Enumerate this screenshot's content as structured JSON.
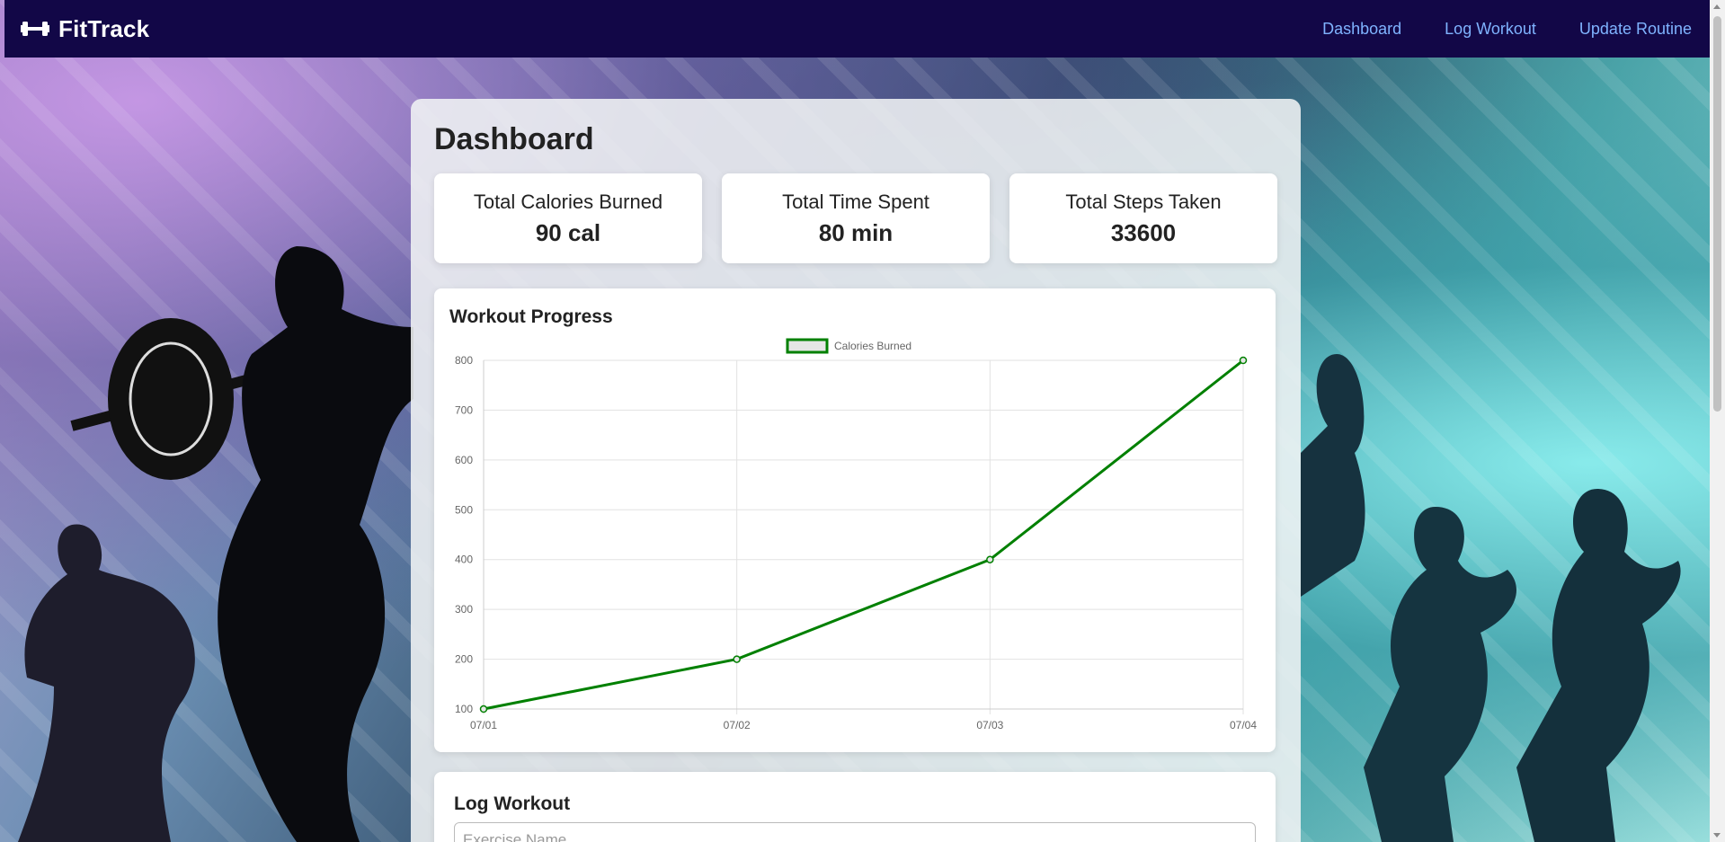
{
  "app": {
    "brand_name": "FitTrack",
    "brand_icon": "dumbbell-icon"
  },
  "nav": {
    "links": [
      "Dashboard",
      "Log Workout",
      "Update Routine"
    ]
  },
  "dashboard": {
    "title": "Dashboard",
    "stats": [
      {
        "label": "Total Calories Burned",
        "value": "90 cal"
      },
      {
        "label": "Total Time Spent",
        "value": "80 min"
      },
      {
        "label": "Total Steps Taken",
        "value": "33600"
      }
    ]
  },
  "progress": {
    "title": "Workout Progress"
  },
  "chart_data": {
    "type": "line",
    "categories": [
      "07/01",
      "07/02",
      "07/03",
      "07/04"
    ],
    "series": [
      {
        "name": "Calories Burned",
        "values": [
          100,
          200,
          400,
          800
        ],
        "color": "#008000"
      }
    ],
    "ylim": [
      100,
      800
    ],
    "yticks": [
      100,
      200,
      300,
      400,
      500,
      600,
      700,
      800
    ],
    "grid": true,
    "legend": "top-center"
  },
  "log_workout": {
    "title": "Log Workout",
    "exercise_placeholder": "Exercise Name"
  },
  "colors": {
    "navbar": "#120747",
    "nav_link": "#7fb3ff",
    "line": "#008000"
  }
}
